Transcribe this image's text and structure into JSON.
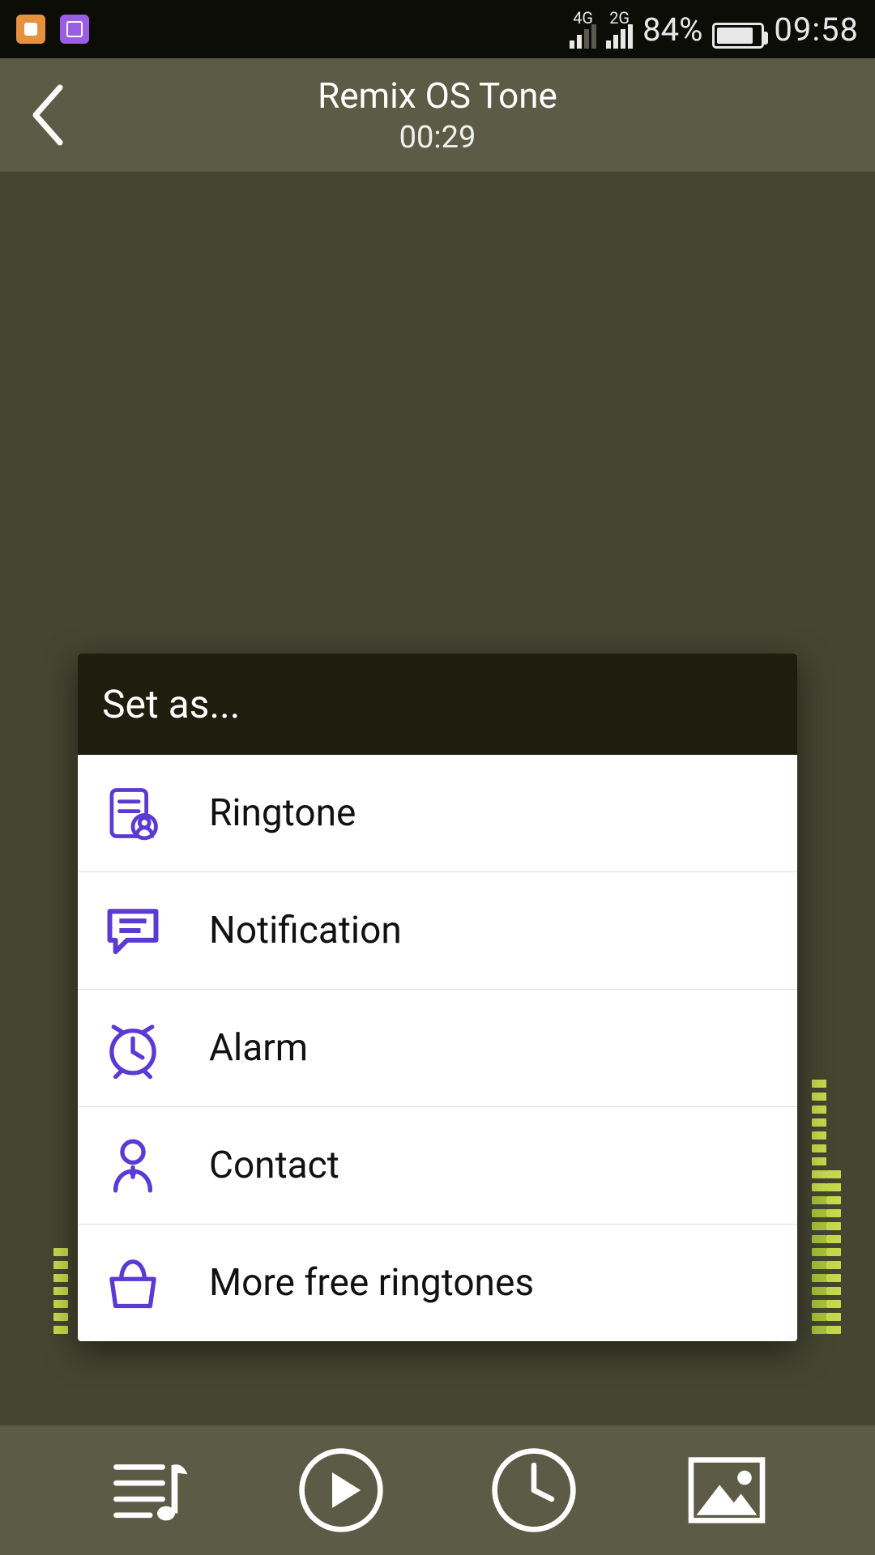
{
  "status": {
    "net1": "4G",
    "net2": "2G",
    "battery_pct": "84%",
    "clock": "09:58"
  },
  "header": {
    "title": "Remix OS Tone",
    "duration": "00:29"
  },
  "dialog": {
    "title": "Set as...",
    "items": [
      {
        "icon": "ringtone-icon",
        "label": "Ringtone"
      },
      {
        "icon": "notification-icon",
        "label": "Notification"
      },
      {
        "icon": "alarm-icon",
        "label": "Alarm"
      },
      {
        "icon": "contact-icon",
        "label": "Contact"
      },
      {
        "icon": "bag-icon",
        "label": "More free ringtones"
      }
    ]
  },
  "bottom": {
    "items": [
      {
        "icon": "playlist-icon"
      },
      {
        "icon": "play-circle-icon"
      },
      {
        "icon": "clock-circle-icon"
      },
      {
        "icon": "image-icon"
      }
    ]
  },
  "colors": {
    "accent": "#5a3ad2",
    "bar_bg": "#5c5c46",
    "content_bg": "#454532"
  }
}
